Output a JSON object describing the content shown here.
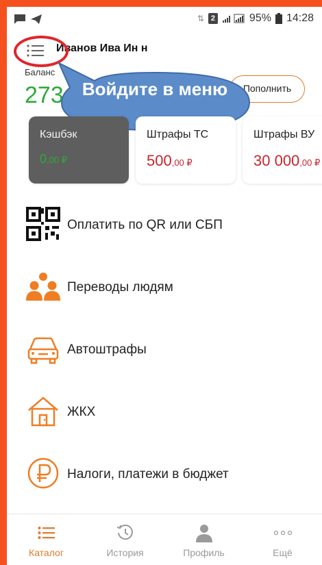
{
  "status_bar": {
    "battery": "95%",
    "time": "14:28",
    "sim_slot": "2"
  },
  "header": {
    "user_name": "Иванов Ива    Ин      н",
    "balance_label": "Баланс",
    "balance_value": "273,",
    "topup_label": "Пополнить",
    "callout_text": "Войдите в меню"
  },
  "cards": [
    {
      "title": "Кэшбэк",
      "amount": "0",
      "cents": ",00 ₽"
    },
    {
      "title": "Штрафы ТС",
      "amount": "500",
      "cents": ",00 ₽"
    },
    {
      "title": "Штрафы ВУ",
      "amount": "30 000",
      "cents": ",00 ₽"
    }
  ],
  "menu": [
    {
      "label": "Оплатить по QR или СБП",
      "icon": "qr-code-icon"
    },
    {
      "label": "Переводы людям",
      "icon": "people-icon"
    },
    {
      "label": "Автоштрафы",
      "icon": "car-icon"
    },
    {
      "label": "ЖКХ",
      "icon": "house-icon"
    },
    {
      "label": "Налоги, платежи в бюджет",
      "icon": "ruble-icon"
    }
  ],
  "bottom_nav": [
    {
      "label": "Каталог",
      "icon": "catalog-icon",
      "active": true
    },
    {
      "label": "История",
      "icon": "history-icon"
    },
    {
      "label": "Профиль",
      "icon": "profile-icon"
    },
    {
      "label": "Ещё",
      "icon": "more-icon"
    }
  ],
  "colors": {
    "accent": "#e07a2c",
    "frame": "#f4511e",
    "balance_green": "#2eaa3a",
    "fine_red": "#c8242b",
    "callout_blue": "#5b8bc9"
  }
}
